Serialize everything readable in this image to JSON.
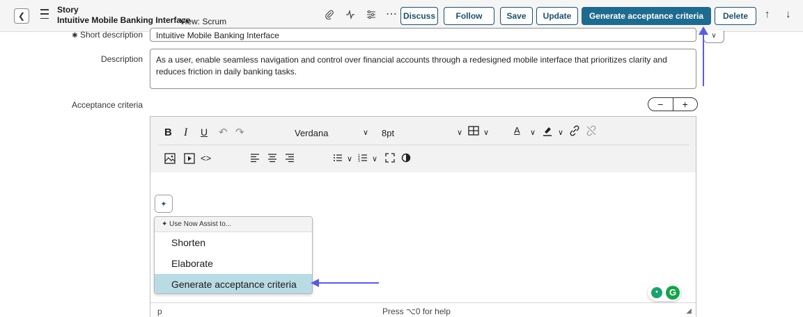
{
  "header": {
    "record_type": "Story",
    "record_title": "Intuitive Mobile Banking Interface",
    "view_label": "View: Scrum",
    "buttons": {
      "discuss": "Discuss",
      "follow": "Follow",
      "save": "Save",
      "update": "Update",
      "generate": "Generate acceptance criteria",
      "delete": "Delete"
    }
  },
  "form": {
    "short_description": {
      "label": "Short description",
      "value": "Intuitive Mobile Banking Interface"
    },
    "description": {
      "label": "Description",
      "value": "As a user, enable seamless navigation and control over financial accounts through a redesigned mobile interface that prioritizes clarity and reduces friction in daily banking tasks."
    },
    "acceptance": {
      "label": "Acceptance criteria"
    }
  },
  "editor": {
    "font_family": "Verdana",
    "font_size": "8pt",
    "status_element": "p",
    "help_text": "Press ⌥0 for help"
  },
  "assist": {
    "header": "Use Now Assist to...",
    "items": [
      "Shorten",
      "Elaborate",
      "Generate acceptance criteria"
    ],
    "selected": "Generate acceptance criteria"
  },
  "colors": {
    "primary_button": "#1f6b8f",
    "button_border": "#1c4f6b",
    "menu_selected": "#b9dbe4",
    "annotation_arrow": "#5b5be0"
  }
}
